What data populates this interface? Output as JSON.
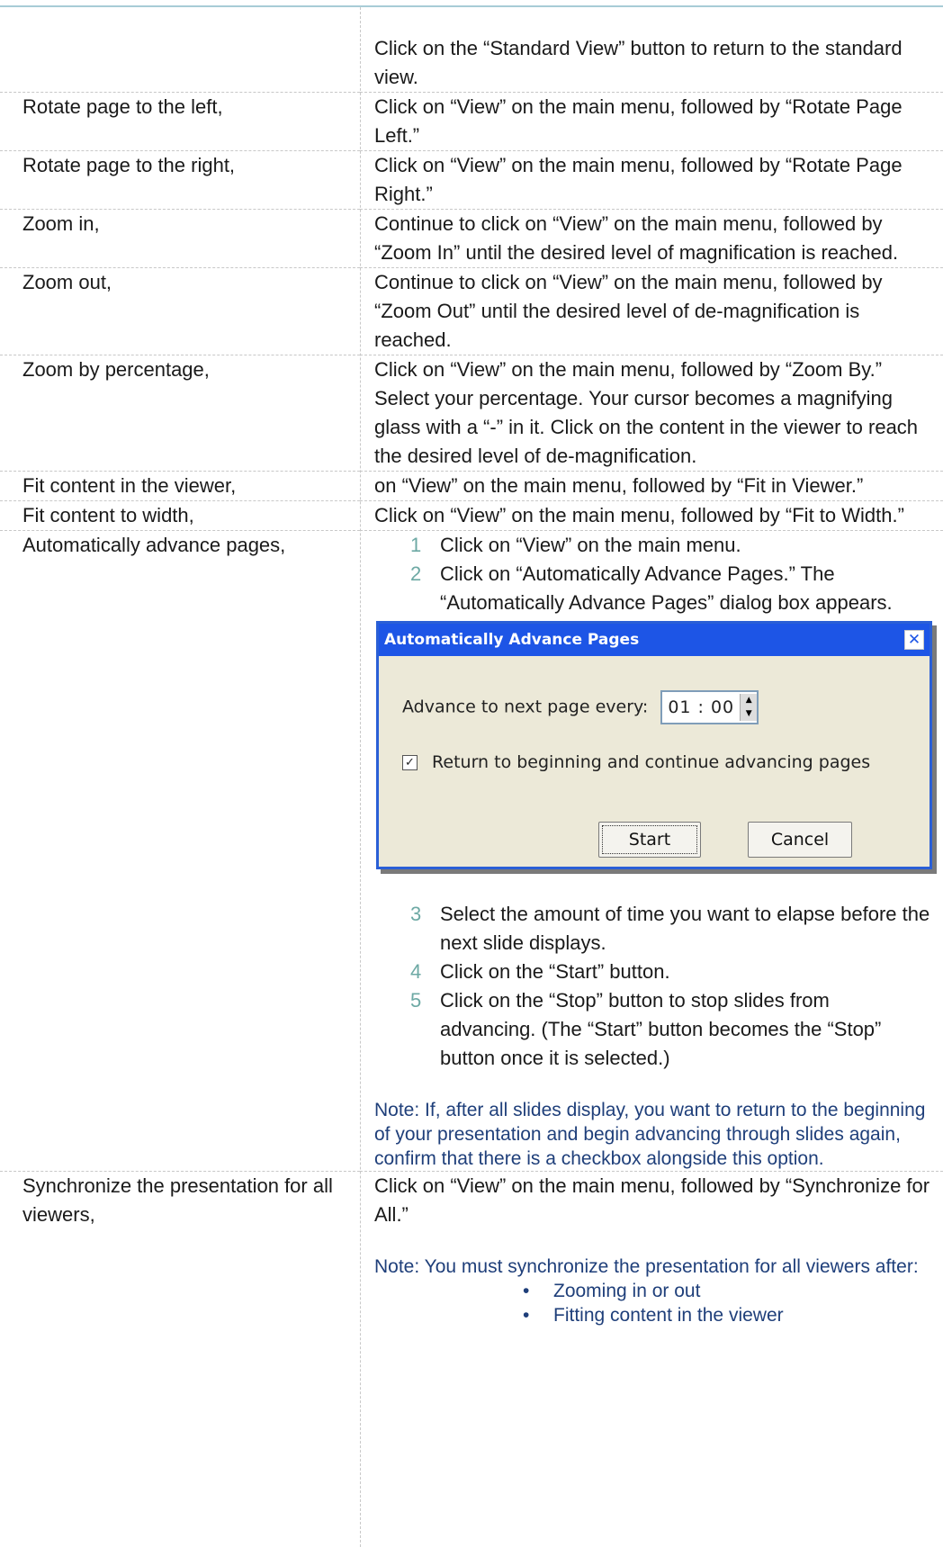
{
  "rows": [
    {
      "task": "",
      "instruction": "Click on the “Standard View” button to return to the standard view."
    },
    {
      "task": "Rotate page to the left,",
      "instruction": "Click on “View” on the main menu, followed by “Rotate Page Left.”"
    },
    {
      "task": "Rotate page to the right,",
      "instruction": "Click on “View” on the main menu, followed by “Rotate Page Right.”"
    },
    {
      "task": "Zoom in,",
      "instruction": "Continue to click on “View” on the main menu, followed by “Zoom In” until the desired level of magnification is reached."
    },
    {
      "task": "Zoom out,",
      "instruction": "Continue to click on “View” on the main menu, followed by “Zoom Out” until the desired level of de-magnification is reached."
    },
    {
      "task": "Zoom by percentage,",
      "instruction": "Click on “View” on the main menu, followed by “Zoom By.”  Select your percentage.  Your cursor becomes a magnifying glass with a “-” in it.  Click on the content in the viewer to reach the desired level of de-magnification."
    },
    {
      "task": "Fit content in the viewer,",
      "instruction": "on “View” on the main menu, followed by “Fit in Viewer.”"
    },
    {
      "task": "Fit content to width,",
      "instruction": "Click on “View” on the main menu, followed by “Fit to Width.”"
    }
  ],
  "auto_advance": {
    "task": "Automatically advance pages,",
    "steps_before": [
      {
        "num": "1",
        "text": "Click on “View” on the main menu."
      },
      {
        "num": "2",
        "text": "Click on “Automatically Advance Pages.”  The “Automatically Advance Pages” dialog box appears."
      }
    ],
    "steps_after": [
      {
        "num": "3",
        "text": "Select the amount of time you want to elapse before the next slide displays."
      },
      {
        "num": "4",
        "text": "Click on the “Start” button."
      },
      {
        "num": "5",
        "text": "Click on the “Stop” button to stop slides from advancing.  (The “Start” button becomes the “Stop” button once it is selected.)"
      }
    ],
    "note": "Note: If, after all slides display, you want to return to the beginning of your presentation and begin advancing through slides again, confirm that there is a checkbox alongside this option."
  },
  "dialog": {
    "title": "Automatically Advance Pages",
    "close_glyph": "✕",
    "interval_label": "Advance to next page every:",
    "interval_value": "01 : 00",
    "loop_checked": true,
    "loop_label": "Return to beginning and continue advancing pages",
    "start_label": "Start",
    "cancel_label": "Cancel"
  },
  "sync": {
    "task": "Synchronize the presentation for all viewers,",
    "instruction": "Click on “View” on the main menu, followed by “Synchronize for All.”",
    "note": "Note: You must synchronize the presentation for all viewers after:",
    "bullets": [
      "Zooming in or out",
      "Fitting content in the viewer"
    ]
  },
  "colors": {
    "note_text": "#1f3f7a",
    "step_number": "#6da9a4",
    "rule": "#a8ccd6",
    "dialog_title": "#1d55e6"
  }
}
